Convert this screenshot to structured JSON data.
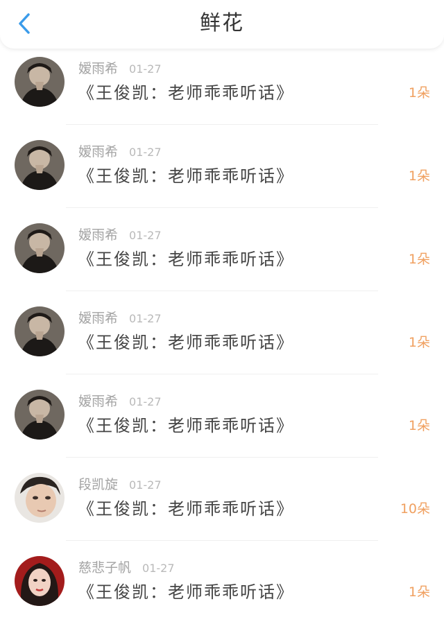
{
  "header": {
    "title": "鲜花",
    "back_icon": "chevron-left-icon",
    "accent_color": "#3a9bea"
  },
  "colors": {
    "count": "#f0a060",
    "name": "#a3a3a3",
    "message": "#444444"
  },
  "items": [
    {
      "name": "嫒雨希",
      "date": "01-27",
      "message": "《王俊凯：老师乖乖听话》",
      "count": "1朵",
      "avatar": "dark-portrait"
    },
    {
      "name": "嫒雨希",
      "date": "01-27",
      "message": "《王俊凯：老师乖乖听话》",
      "count": "1朵",
      "avatar": "dark-portrait"
    },
    {
      "name": "嫒雨希",
      "date": "01-27",
      "message": "《王俊凯：老师乖乖听话》",
      "count": "1朵",
      "avatar": "dark-portrait"
    },
    {
      "name": "嫒雨希",
      "date": "01-27",
      "message": "《王俊凯：老师乖乖听话》",
      "count": "1朵",
      "avatar": "dark-portrait"
    },
    {
      "name": "嫒雨希",
      "date": "01-27",
      "message": "《王俊凯：老师乖乖听话》",
      "count": "1朵",
      "avatar": "dark-portrait"
    },
    {
      "name": "段凯旋",
      "date": "01-27",
      "message": "《王俊凯：老师乖乖听话》",
      "count": "10朵",
      "avatar": "light-portrait"
    },
    {
      "name": "慈悲子帆",
      "date": "01-27",
      "message": "《王俊凯：老师乖乖听话》",
      "count": "1朵",
      "avatar": "red-portrait"
    }
  ]
}
